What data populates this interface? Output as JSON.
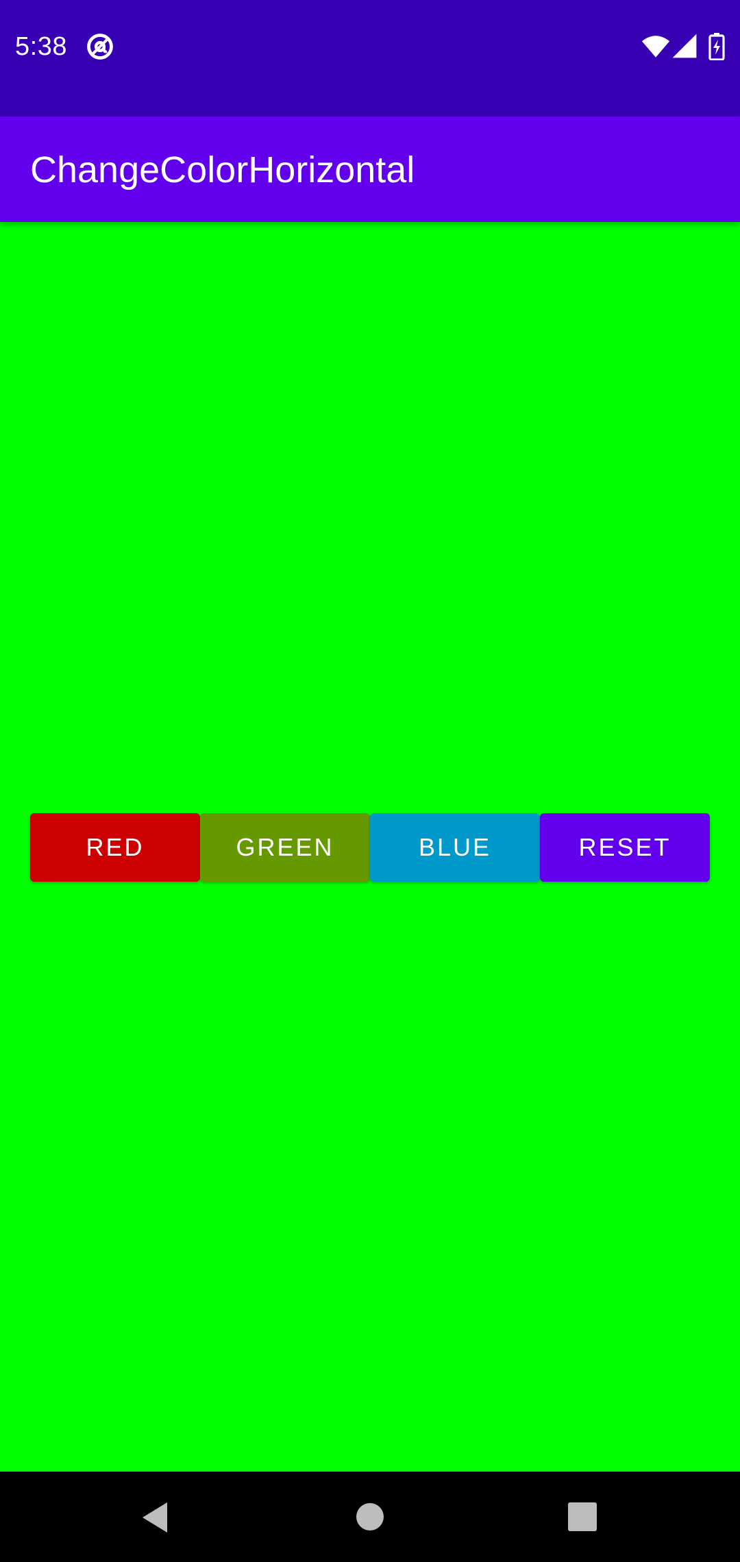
{
  "status_bar": {
    "time": "5:38",
    "app_icon": "at-sign-notification-icon",
    "wifi_icon": "wifi-icon",
    "signal_icon": "cell-signal-icon",
    "battery_icon": "battery-charging-icon",
    "background": "#3700B3"
  },
  "app_bar": {
    "title": "ChangeColorHorizontal",
    "background": "#6200EE"
  },
  "content": {
    "background": "#00FF00"
  },
  "buttons": [
    {
      "label": "RED",
      "color": "#CC0000"
    },
    {
      "label": "GREEN",
      "color": "#669900"
    },
    {
      "label": "BLUE",
      "color": "#0099CC"
    },
    {
      "label": "RESET",
      "color": "#6200EE"
    }
  ],
  "nav_bar": {
    "back_icon": "back-triangle-icon",
    "home_icon": "home-circle-icon",
    "recents_icon": "recents-square-icon"
  }
}
